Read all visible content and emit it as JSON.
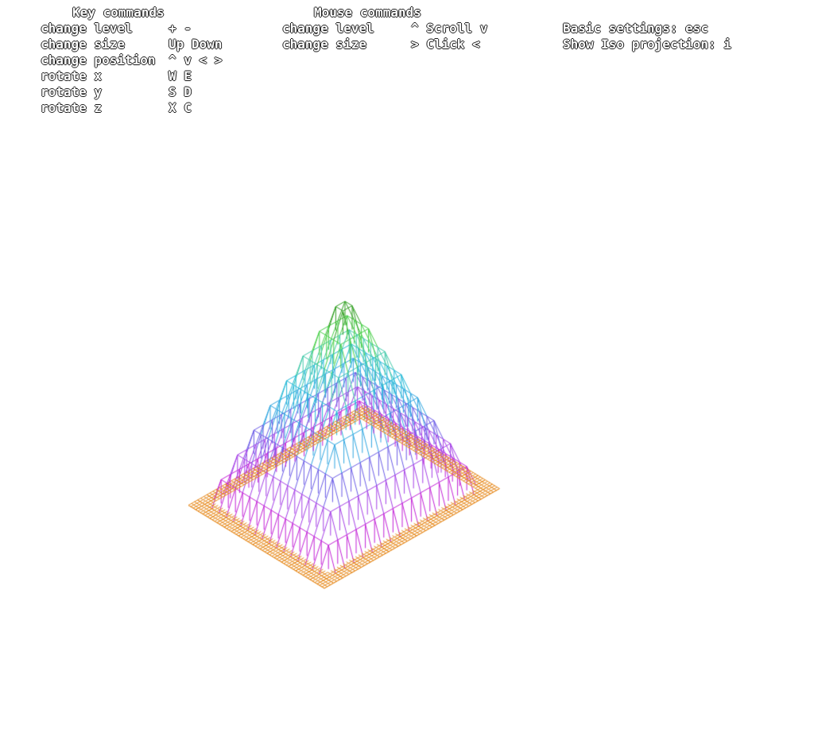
{
  "key_commands": {
    "header": "Key commands",
    "rows": [
      {
        "label": "change level",
        "keys": "+ -"
      },
      {
        "label": "change size",
        "keys": "Up Down"
      },
      {
        "label": "change position",
        "keys": "^ v < >"
      },
      {
        "label": "rotate x",
        "keys": "W E"
      },
      {
        "label": "rotate y",
        "keys": "S D"
      },
      {
        "label": "rotate z",
        "keys": "X C"
      }
    ]
  },
  "mouse_commands": {
    "header": "Mouse commands",
    "rows": [
      {
        "label": "change level",
        "keys": "^ Scroll v"
      },
      {
        "label": "change size",
        "keys": "> Click <"
      }
    ]
  },
  "settings": {
    "basic": "Basic settings: esc",
    "iso": "Show Iso projection: i"
  },
  "colors": {
    "text": "#ffffff",
    "text_outline": "#1a1a1a",
    "background": "#ffffff",
    "level_colors": [
      "#e68a1e",
      "#c21fd6",
      "#a43ee6",
      "#6a5be6",
      "#2ea5e0",
      "#22b8d6",
      "#3fc9a8",
      "#46cf46",
      "#2e9e1f",
      "#7ad655"
    ]
  },
  "model": {
    "grid_size": 20,
    "levels": [
      0,
      1,
      2,
      3,
      4,
      5,
      6,
      7,
      8,
      9
    ]
  }
}
